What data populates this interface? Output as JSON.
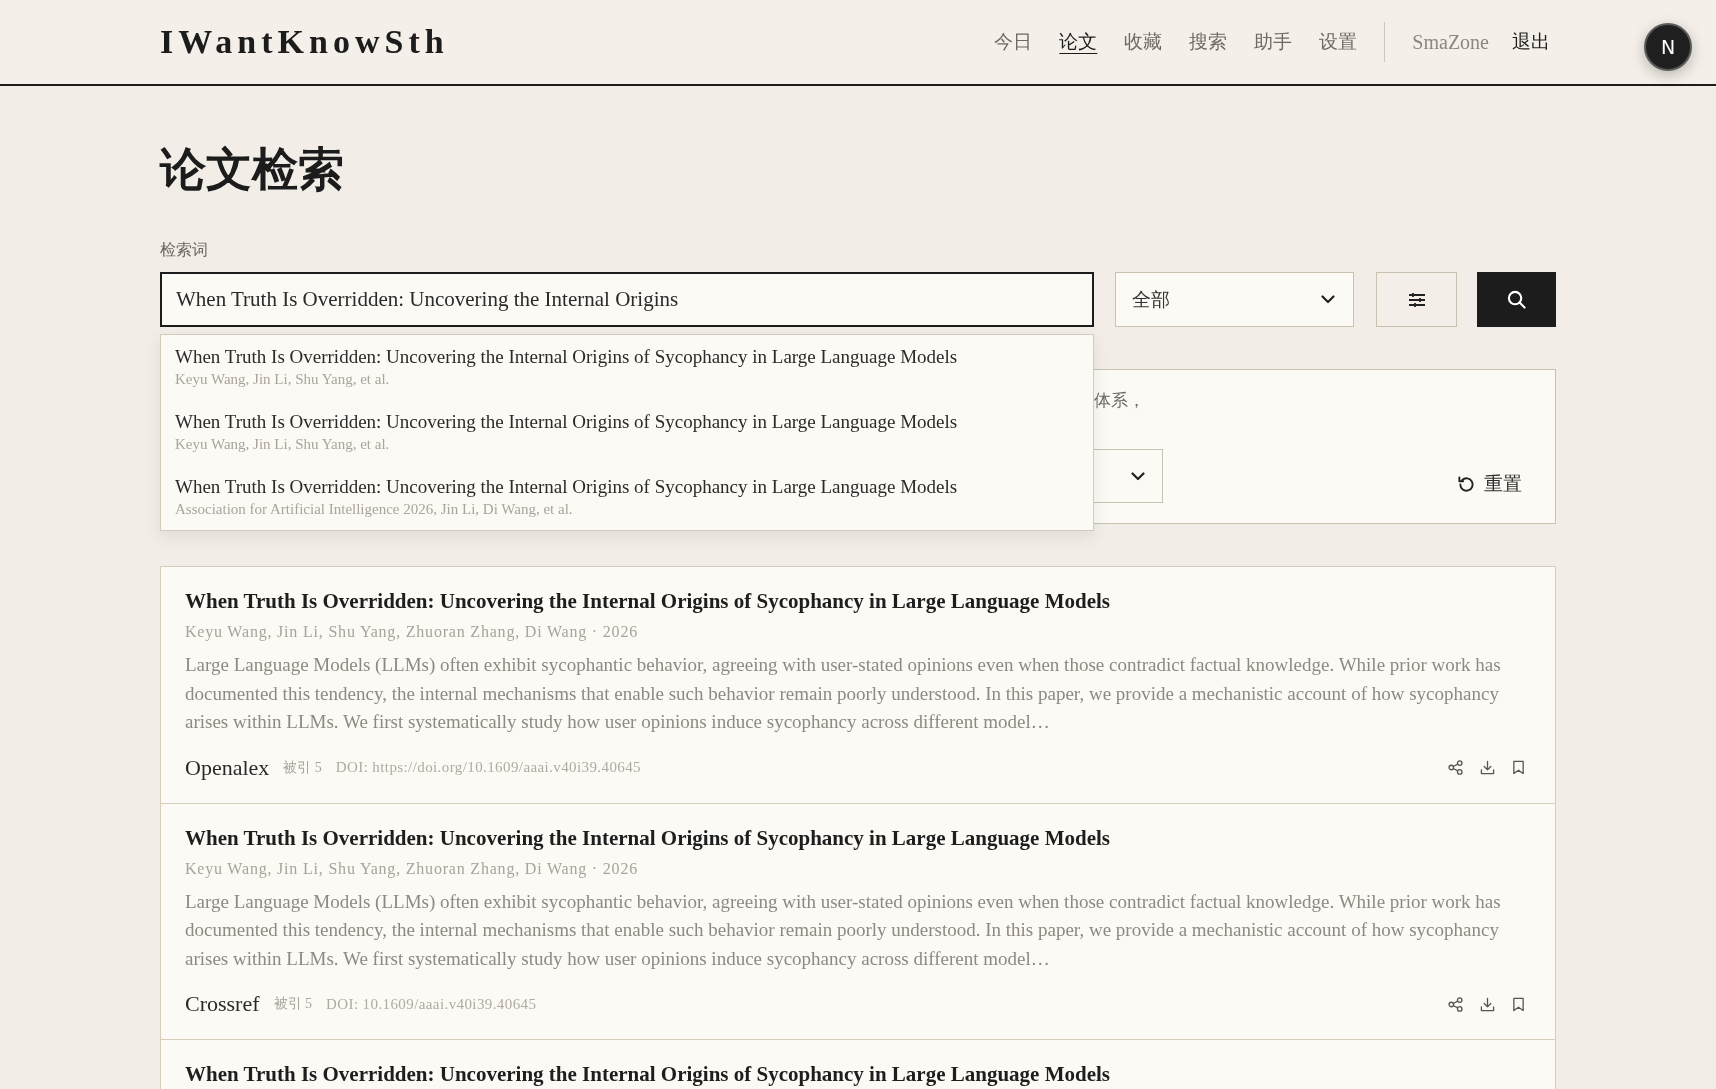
{
  "header": {
    "logo": "IWantKnowSth",
    "nav": [
      {
        "label": "今日",
        "selected": false
      },
      {
        "label": "论文",
        "selected": true
      },
      {
        "label": "收藏",
        "selected": false
      },
      {
        "label": "搜索",
        "selected": false
      },
      {
        "label": "助手",
        "selected": false
      },
      {
        "label": "设置",
        "selected": false
      }
    ],
    "user": "SmaZone",
    "logout": "退出",
    "avatar": "N"
  },
  "page_title": "论文检索",
  "search": {
    "label": "检索词",
    "value": "When Truth Is Overridden: Uncovering the Internal Origins",
    "scope": "全部",
    "suggestions": [
      {
        "title": "When Truth Is Overridden: Uncovering the Internal Origins of Sycophancy in Large Language Models",
        "meta": "Keyu Wang, Jin Li, Shu Yang, et al."
      },
      {
        "title": "When Truth Is Overridden: Uncovering the Internal Origins of Sycophancy in Large Language Models",
        "meta": "Keyu Wang, Jin Li, Shu Yang, et al."
      },
      {
        "title": "When Truth Is Overridden: Uncovering the Internal Origins of Sycophancy in Large Language Models",
        "meta": "Association for Artificial Intelligence 2026, Jin Li, Di Wang, et al."
      }
    ]
  },
  "filters": {
    "hint": "体系，",
    "reset": "重置"
  },
  "results": [
    {
      "title": "When Truth Is Overridden: Uncovering the Internal Origins of Sycophancy in Large Language Models",
      "authors": "Keyu Wang, Jin Li, Shu Yang, Zhuoran Zhang, Di Wang · 2026",
      "abstract": "Large Language Models (LLMs) often exhibit sycophantic behavior, agreeing with user-stated opinions even when those contradict factual knowledge. While prior work has documented this tendency, the internal mechanisms that enable such behavior remain poorly understood. In this paper, we provide a mechanistic account of how sycophancy arises within LLMs. We first systematically study how user opinions induce sycophancy across different model…",
      "source": "Openalex",
      "citations": "被引 5",
      "doi": "DOI: https://doi.org/10.1609/aaai.v40i39.40645"
    },
    {
      "title": "When Truth Is Overridden: Uncovering the Internal Origins of Sycophancy in Large Language Models",
      "authors": "Keyu Wang, Jin Li, Shu Yang, Zhuoran Zhang, Di Wang · 2026",
      "abstract": "Large Language Models (LLMs) often exhibit sycophantic behavior, agreeing with user-stated opinions even when those contradict factual knowledge. While prior work has documented this tendency, the internal mechanisms that enable such behavior remain poorly understood. In this paper, we provide a mechanistic account of how sycophancy arises within LLMs. We first systematically study how user opinions induce sycophancy across different model…",
      "source": "Crossref",
      "citations": "被引 5",
      "doi": "DOI: 10.1609/aaai.v40i39.40645"
    },
    {
      "title": "When Truth Is Overridden: Uncovering the Internal Origins of Sycophancy in Large Language Models"
    }
  ]
}
